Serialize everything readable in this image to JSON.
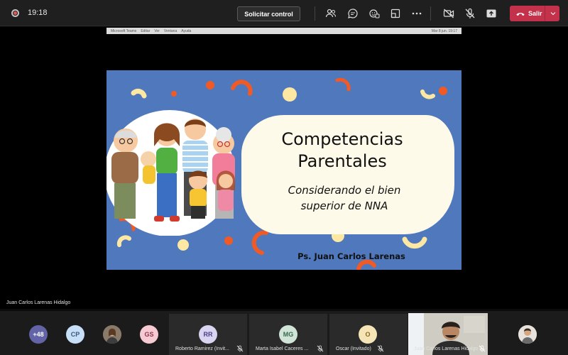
{
  "topbar": {
    "time": "19:18",
    "control_label": "Solicitar control",
    "leave_label": "Salir",
    "icons": [
      "people-icon",
      "chat-icon",
      "reactions-icon",
      "rooms-icon",
      "more-icon",
      "camera-off-icon",
      "mic-off-icon",
      "share-icon"
    ]
  },
  "shared_screen": {
    "menubar": [
      "Microsoft Teams",
      "Editar",
      "Ver",
      "Ventana",
      "Ayuda"
    ],
    "menubar_right": "Mar 8 jun.  19:17"
  },
  "slide": {
    "title_line1": "Competencias",
    "title_line2": "Parentales",
    "subtitle_line1": "Considerando el bien",
    "subtitle_line2": "superior de NNA",
    "author": "Ps. Juan Carlos Larenas",
    "colors": {
      "background": "#4f78bd",
      "bubble": "#fdfaea",
      "orange": "#f15a24",
      "yellow": "#fde8a3"
    }
  },
  "presenter_label": "Juan Carlos Larenas Hidalgo",
  "participants": {
    "overflow": "+48",
    "avatars": [
      {
        "initials": "CP",
        "color": "#c7dff7",
        "text": "#3a5a80"
      },
      {
        "initials": "GS",
        "color": "#f7c9d2",
        "text": "#8a3a4a"
      }
    ],
    "tiles": [
      {
        "initials": "RR",
        "name": "Roberto Ramirez (Invit...",
        "color": "#d9d4f0",
        "text": "#4b3f8a"
      },
      {
        "initials": "MG",
        "name": "Marta Isabel Caceres ...",
        "color": "#d0e4d8",
        "text": "#3a6a4e"
      },
      {
        "initials": "O",
        "name": "Oscar (Invitado)",
        "color": "#f5e4b6",
        "text": "#8a6a1a"
      }
    ],
    "video_name": "Juan Carlos Larenas Hidalgo"
  }
}
